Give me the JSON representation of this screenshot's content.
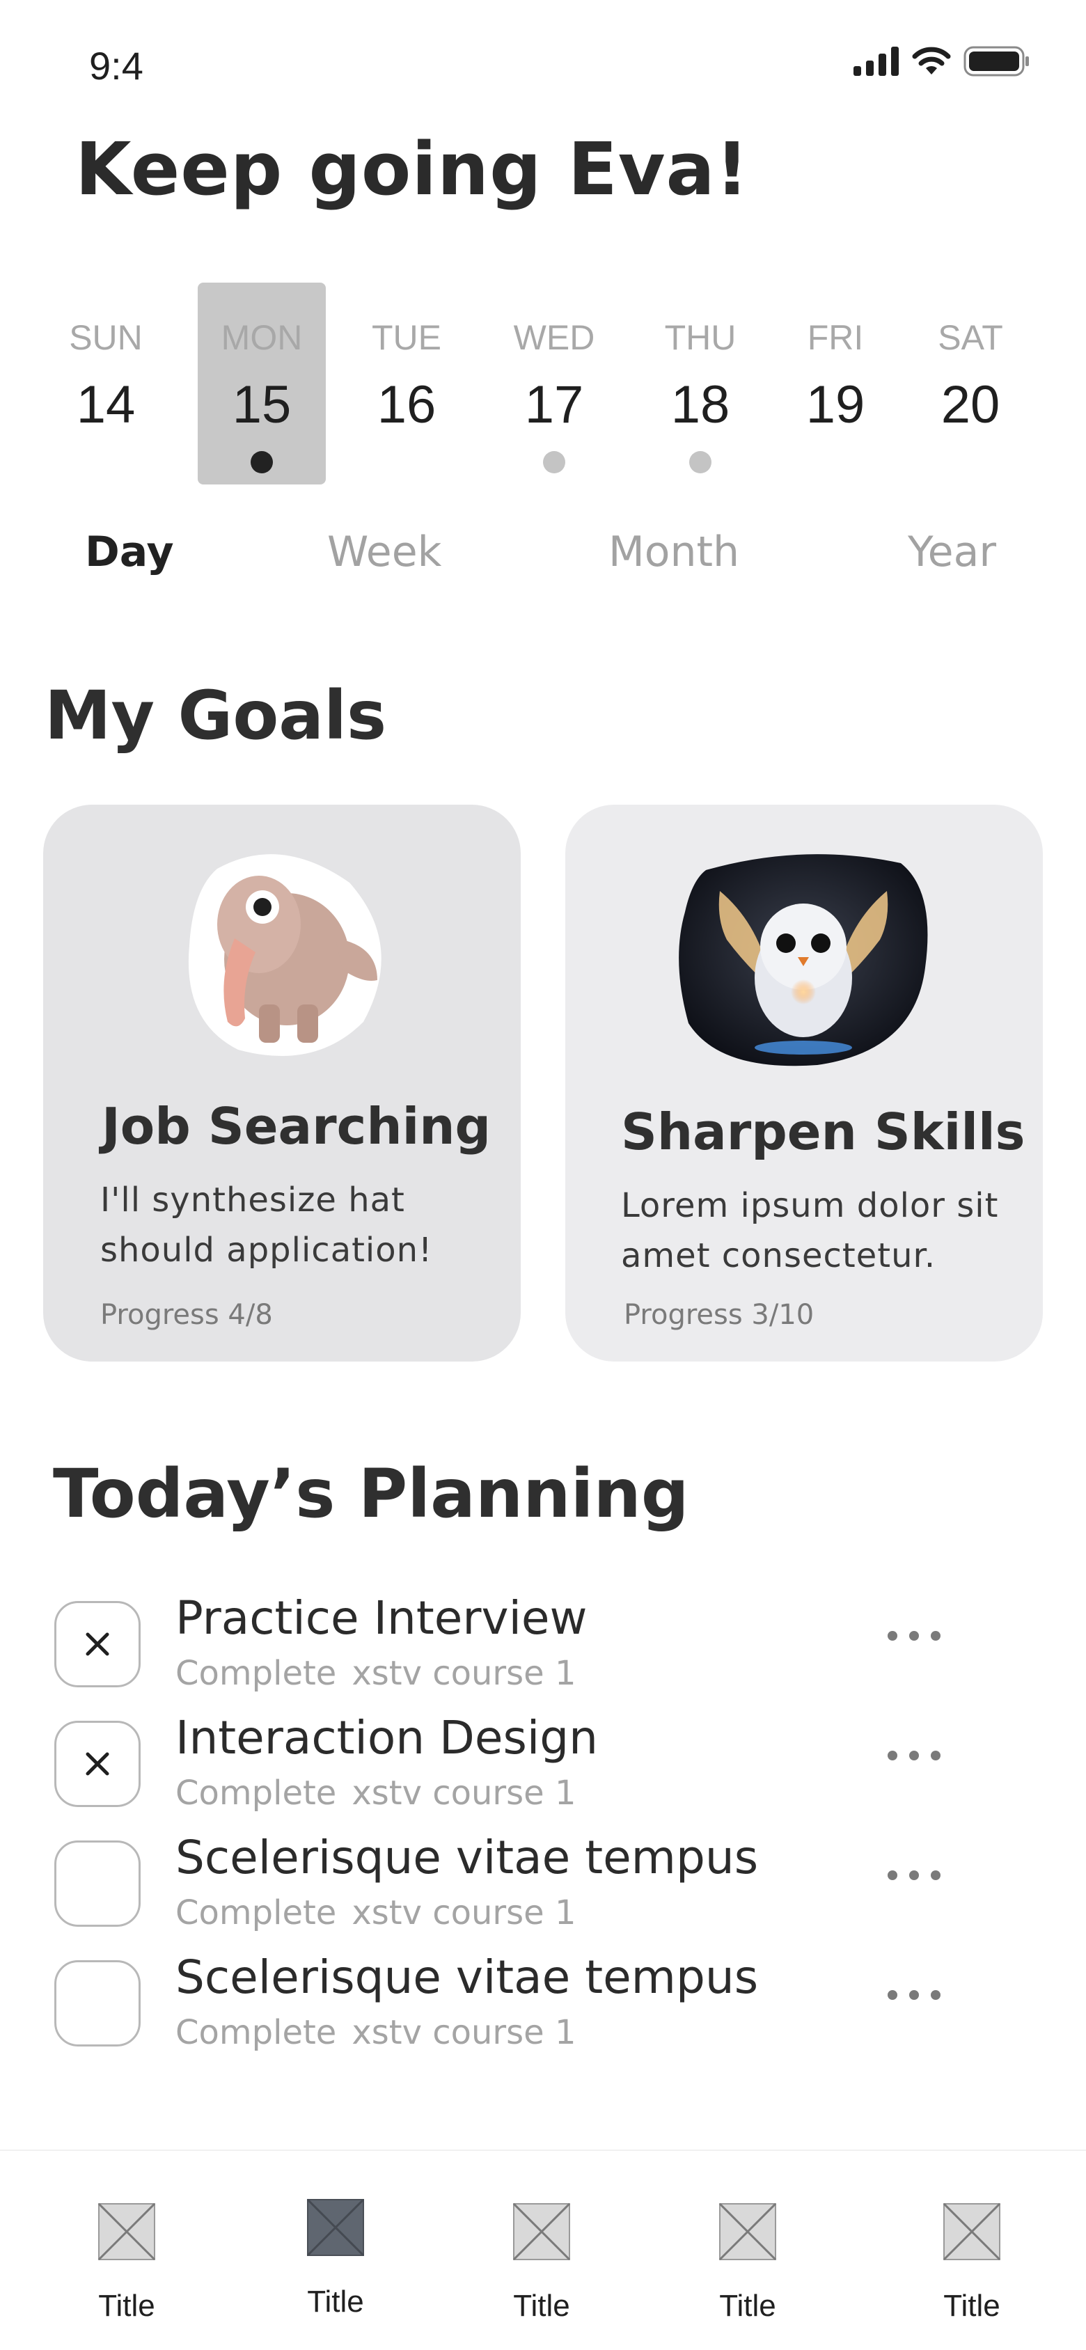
{
  "status_bar": {
    "time": "9:4"
  },
  "greeting": "Keep going Eva!",
  "calendar": {
    "days": [
      {
        "name": "SUN",
        "date": "14"
      },
      {
        "name": "MON",
        "date": "15"
      },
      {
        "name": "TUE",
        "date": "16"
      },
      {
        "name": "WED",
        "date": "17"
      },
      {
        "name": "THU",
        "date": "18"
      },
      {
        "name": "FRI",
        "date": "19"
      },
      {
        "name": "SAT",
        "date": "20"
      }
    ],
    "selected_day": "MON"
  },
  "period_tabs": [
    {
      "label": "Day",
      "active": true
    },
    {
      "label": "Week"
    },
    {
      "label": "Month"
    },
    {
      "label": "Year"
    }
  ],
  "goals": {
    "title": "My Goals",
    "cards": [
      {
        "image": "elephant-illustration",
        "title": "Job Searching",
        "desc_line1": "I'll synthesize hat",
        "desc_line2": "should application!",
        "progress": "Progress 4/8"
      },
      {
        "image": "owl-illustration",
        "title": "Sharpen Skills",
        "desc_line1": "Lorem ipsum dolor sit",
        "desc_line2": "amet consectetur.",
        "progress": "Progress 3/10"
      }
    ]
  },
  "planning": {
    "title": "Today’s Planning",
    "items": [
      {
        "title": "Practice Interview",
        "status": "Complete",
        "course": "xstv course 1",
        "checked": true
      },
      {
        "title": "Interaction Design",
        "status": "Complete",
        "course": "xstv course 1",
        "checked": true
      },
      {
        "title": "Scelerisque vitae tempus",
        "status": "Complete",
        "course": "xstv course 1",
        "checked": false
      },
      {
        "title": "Scelerisque vitae tempus",
        "status": "Complete",
        "course": "xstv course 1",
        "checked": false
      }
    ]
  },
  "bottom_nav": {
    "items": [
      {
        "label": "Title"
      },
      {
        "label": "Title",
        "active": true
      },
      {
        "label": "Title"
      },
      {
        "label": "Title"
      },
      {
        "label": "Title"
      }
    ]
  },
  "colors": {
    "selected_day_bg": "#c8c8c8",
    "goal_card_bg": "#e4e4e6",
    "text_dark": "#2f2f2f",
    "text_muted": "#a4a4a4"
  }
}
